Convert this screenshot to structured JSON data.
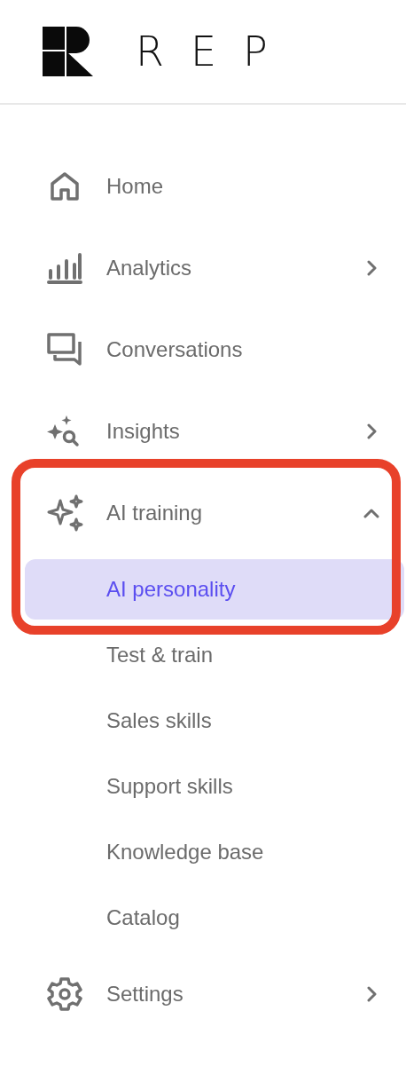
{
  "logo": {
    "text": "REP"
  },
  "nav": {
    "items": [
      {
        "label": "Home"
      },
      {
        "label": "Analytics",
        "expanded": false
      },
      {
        "label": "Conversations"
      },
      {
        "label": "Insights",
        "expanded": false
      },
      {
        "label": "AI training",
        "expanded": true,
        "highlighted": true,
        "children": [
          {
            "label": "AI personality",
            "selected": true
          },
          {
            "label": "Test & train",
            "selected": false
          },
          {
            "label": "Sales skills",
            "selected": false
          },
          {
            "label": "Support skills",
            "selected": false
          },
          {
            "label": "Knowledge base",
            "selected": false
          },
          {
            "label": "Catalog",
            "selected": false
          }
        ]
      },
      {
        "label": "Settings",
        "expanded": false
      }
    ]
  }
}
